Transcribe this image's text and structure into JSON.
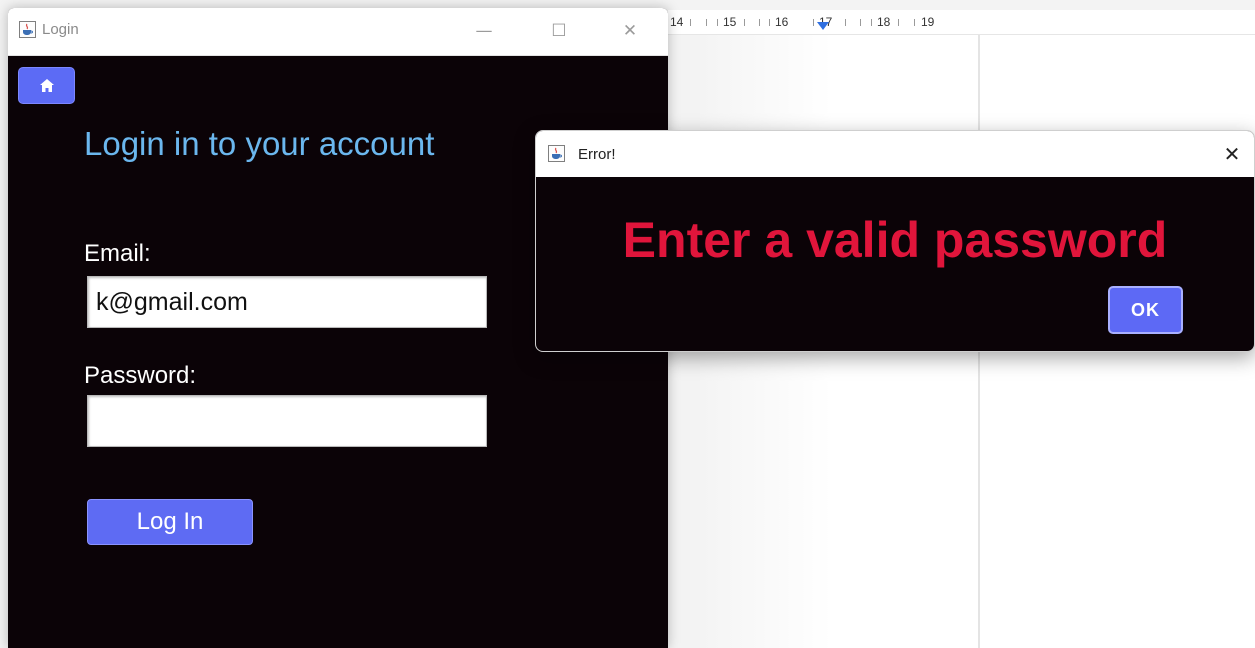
{
  "background_app": {
    "ruler_numbers": [
      "14",
      "15",
      "16",
      "17",
      "18",
      "19"
    ]
  },
  "login_window": {
    "title": "Login",
    "title_icon": "java-cup-icon",
    "controls": {
      "minimize": "—",
      "maximize": "☐",
      "close": "✕"
    },
    "home_icon": "home-icon",
    "heading": "Login in to your account",
    "email_label": "Email:",
    "email_value": "k@gmail.com",
    "password_label": "Password:",
    "password_value": "",
    "login_button": "Log In"
  },
  "error_dialog": {
    "title": "Error!",
    "title_icon": "java-cup-icon",
    "close": "✕",
    "message": "Enter a valid password",
    "ok_button": "OK"
  },
  "colors": {
    "window_bg": "#0b0307",
    "heading": "#6bb7ee",
    "accent_button": "#5e6bf3",
    "error_text": "#e0153b"
  }
}
